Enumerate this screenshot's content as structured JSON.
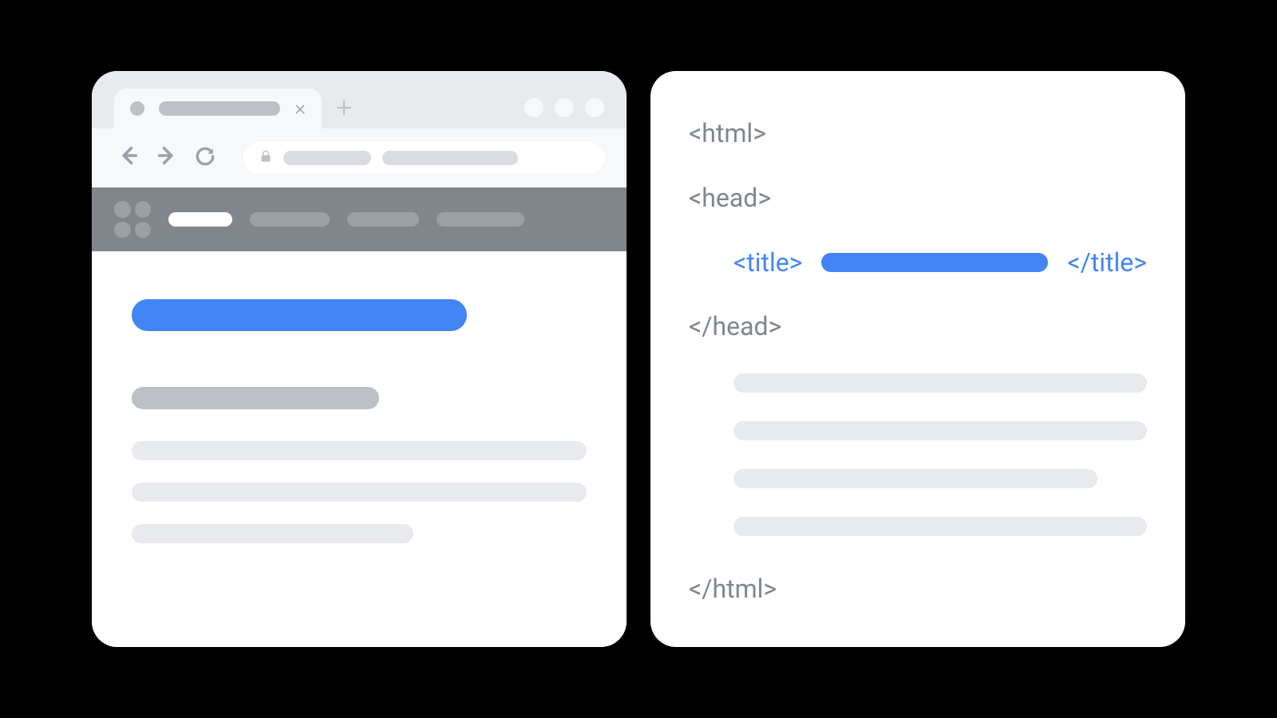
{
  "colors": {
    "accent_blue": "#4285f4",
    "gray_text": "#80868b",
    "placeholder_light": "#e8eaed",
    "placeholder_mid": "#bdc1c6",
    "site_header": "#80868b"
  },
  "browser": {
    "tab_close_glyph": "×",
    "new_tab_glyph": "+"
  },
  "code": {
    "html_open": "<html>",
    "head_open": "<head>",
    "title_open": "<title>",
    "title_close": "</title>",
    "head_close": "</head>",
    "html_close": "</html>"
  }
}
